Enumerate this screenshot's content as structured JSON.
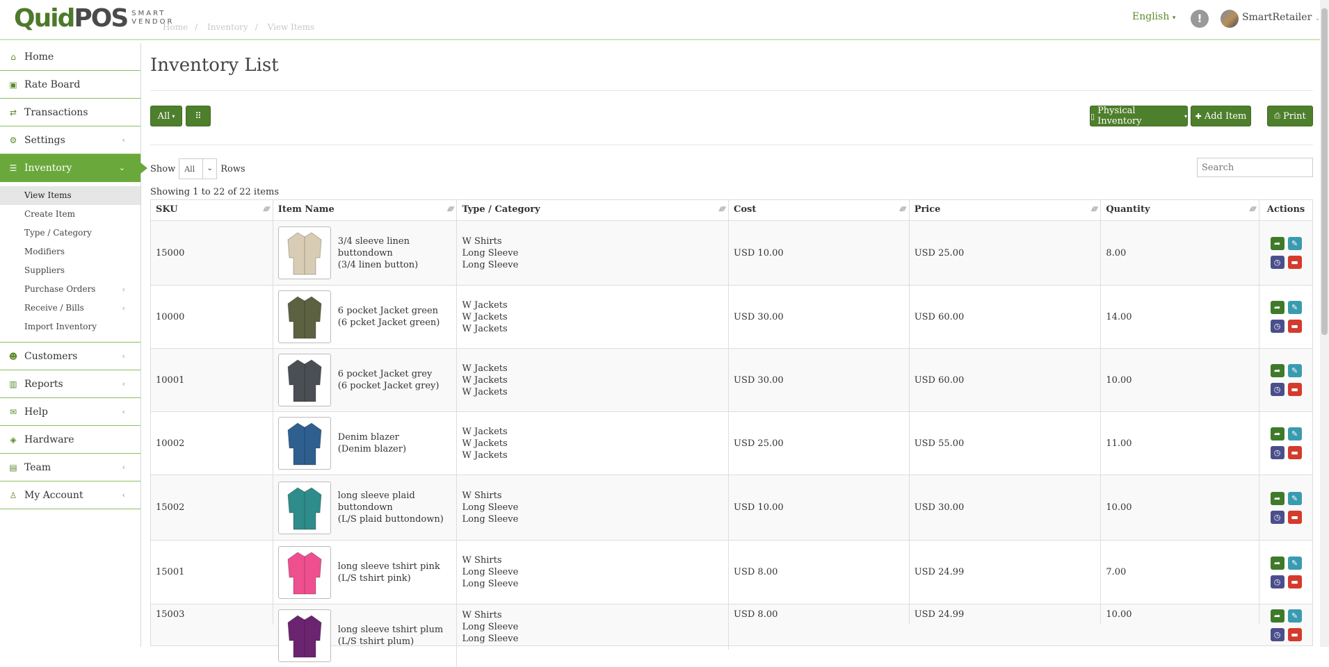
{
  "header": {
    "logo_main": "QuidPOS",
    "logo_sub_1": "SMART",
    "logo_sub_2": "VENDOR",
    "breadcrumb": [
      "Home",
      "Inventory",
      "View Items"
    ],
    "language": "English",
    "username": "SmartRetailer"
  },
  "sidebar": {
    "items": [
      {
        "label": "Home",
        "icon": "home-icon"
      },
      {
        "label": "Rate Board",
        "icon": "money-icon"
      },
      {
        "label": "Transactions",
        "icon": "exchange-icon"
      },
      {
        "label": "Settings",
        "icon": "gear-icon"
      },
      {
        "label": "Inventory",
        "icon": "list-icon"
      },
      {
        "label": "Customers",
        "icon": "users-icon"
      },
      {
        "label": "Reports",
        "icon": "chart-icon"
      },
      {
        "label": "Help",
        "icon": "envelope-icon"
      },
      {
        "label": "Hardware",
        "icon": "cube-icon"
      },
      {
        "label": "Team",
        "icon": "id-card-icon"
      },
      {
        "label": "My Account",
        "icon": "user-icon"
      }
    ],
    "inventory_sub": [
      {
        "label": "View Items"
      },
      {
        "label": "Create Item"
      },
      {
        "label": "Type / Category"
      },
      {
        "label": "Modifiers"
      },
      {
        "label": "Suppliers"
      },
      {
        "label": "Purchase Orders"
      },
      {
        "label": "Receive / Bills"
      },
      {
        "label": "Import Inventory"
      }
    ]
  },
  "main": {
    "title": "Inventory List",
    "filter_label": "All",
    "physical_inventory_label": "Physical Inventory",
    "add_item_label": "Add Item",
    "print_label": "Print",
    "show_label": "Show",
    "rows_value": "All",
    "rows_label": "Rows",
    "search_placeholder": "Search",
    "showing_text": "Showing 1 to 22 of 22 items",
    "columns": [
      "SKU",
      "Item Name",
      "Type / Category",
      "Cost",
      "Price",
      "Quantity",
      "Actions"
    ],
    "rows": [
      {
        "sku": "15000",
        "name_lines": [
          "3/4 sleeve linen",
          "buttondown",
          "(3/4 linen button)"
        ],
        "type_lines": [
          "W Shirts",
          "Long Sleeve",
          "Long Sleeve"
        ],
        "cost": "USD 10.00",
        "price": "USD 25.00",
        "qty": "8.00",
        "image_color": "#d8cdb4"
      },
      {
        "sku": "10000",
        "name_lines": [
          "6 pocket Jacket green",
          "(6 pcket Jacket green)"
        ],
        "type_lines": [
          "W Jackets",
          "W Jackets",
          "W Jackets"
        ],
        "cost": "USD 30.00",
        "price": "USD 60.00",
        "qty": "14.00",
        "image_color": "#5c6142"
      },
      {
        "sku": "10001",
        "name_lines": [
          "6 pocket Jacket grey",
          "(6 pocket Jacket grey)"
        ],
        "type_lines": [
          "W Jackets",
          "W Jackets",
          "W Jackets"
        ],
        "cost": "USD 30.00",
        "price": "USD 60.00",
        "qty": "10.00",
        "image_color": "#4a4e55"
      },
      {
        "sku": "10002",
        "name_lines": [
          "Denim blazer",
          "(Denim blazer)"
        ],
        "type_lines": [
          "W Jackets",
          "W Jackets",
          "W Jackets"
        ],
        "cost": "USD 25.00",
        "price": "USD 55.00",
        "qty": "11.00",
        "image_color": "#2f5f8f"
      },
      {
        "sku": "15002",
        "name_lines": [
          "long sleeve plaid",
          "buttondown",
          "(L/S plaid buttondown)"
        ],
        "type_lines": [
          "W Shirts",
          "Long Sleeve",
          "Long Sleeve"
        ],
        "cost": "USD 10.00",
        "price": "USD 30.00",
        "qty": "10.00",
        "image_color": "#2e8c8a"
      },
      {
        "sku": "15001",
        "name_lines": [
          "long sleeve tshirt pink",
          "(L/S tshirt pink)"
        ],
        "type_lines": [
          "W Shirts",
          "Long Sleeve",
          "Long Sleeve"
        ],
        "cost": "USD 8.00",
        "price": "USD 24.99",
        "qty": "7.00",
        "image_color": "#ee4f8f"
      },
      {
        "sku": "15003",
        "name_lines": [
          "long sleeve tshirt plum",
          "(L/S tshirt plum)"
        ],
        "type_lines": [
          "W Shirts",
          "Long Sleeve",
          "Long Sleeve"
        ],
        "cost": "USD 8.00",
        "price": "USD 24.99",
        "qty": "10.00",
        "image_color": "#6b2470"
      }
    ]
  },
  "colors": {
    "brand_green": "#4e7f2c",
    "active_green": "#6aa83c",
    "edit_teal": "#3a9bb0",
    "history_indigo": "#4a4f8c",
    "delete_red": "#d33b2c"
  }
}
